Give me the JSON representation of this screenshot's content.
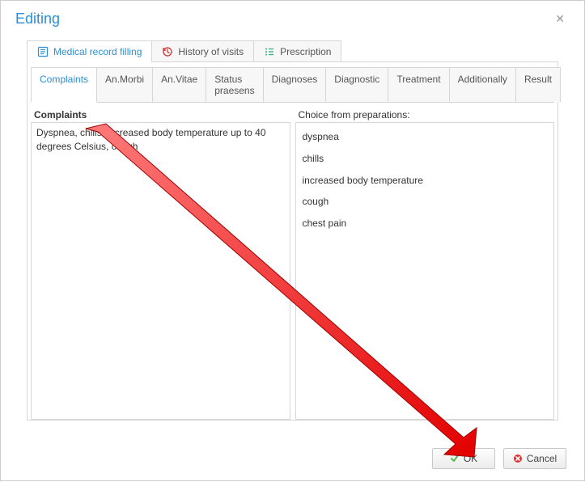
{
  "dialog": {
    "title": "Editing"
  },
  "outer_tabs": {
    "medical": "Medical record filling",
    "history": "History of visits",
    "prescription": "Prescription"
  },
  "inner_tabs": {
    "complaints": "Complaints",
    "an_morbi": "An.Morbi",
    "an_vitae": "An.Vitae",
    "status_praesens": "Status praesens",
    "diagnoses": "Diagnoses",
    "diagnostic": "Diagnostic",
    "treatment": "Treatment",
    "additionally": "Additionally",
    "result": "Result"
  },
  "left_panel": {
    "header": "Complaints",
    "text": "Dyspnea, chills, increased body temperature up to 40 degrees Celsius, cough"
  },
  "right_panel": {
    "header": "Choice from preparations:",
    "items": {
      "0": "dyspnea",
      "1": "chills",
      "2": "increased body temperature",
      "3": "cough",
      "4": "chest pain"
    }
  },
  "buttons": {
    "ok": "OK",
    "cancel": "Cancel"
  }
}
